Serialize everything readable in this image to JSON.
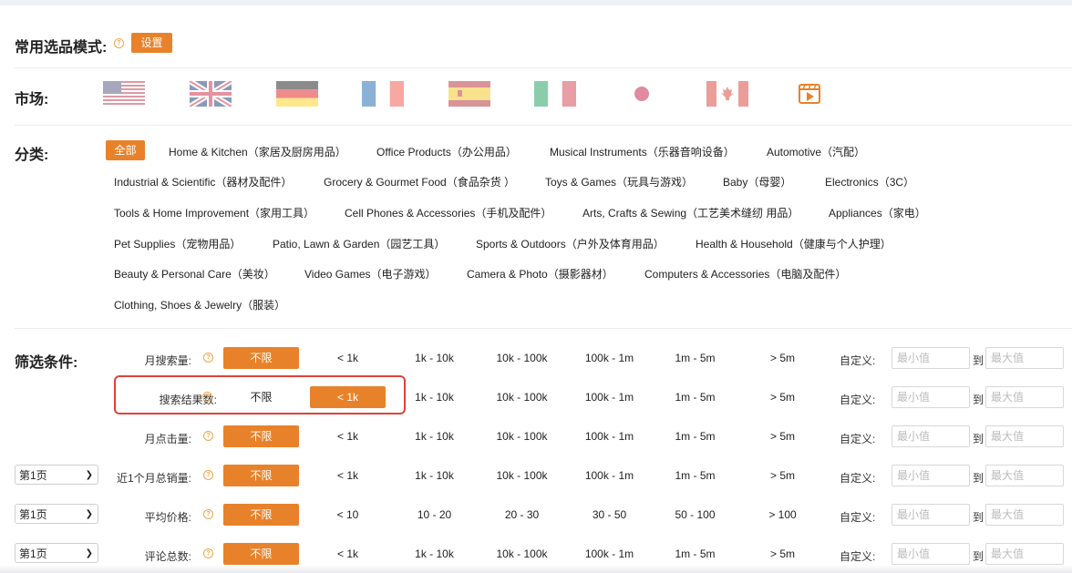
{
  "mode": {
    "label": "常用选品模式:",
    "button": "设置"
  },
  "market": {
    "label": "市场:",
    "flags": [
      "us-flag-icon",
      "uk-flag-icon",
      "de-flag-icon",
      "fr-flag-icon",
      "es-flag-icon",
      "it-flag-icon",
      "jp-flag-icon",
      "ca-flag-icon",
      "video-icon"
    ]
  },
  "category": {
    "label": "分类:",
    "all": "全部",
    "rows": [
      [
        "Home & Kitchen（家居及厨房用品）",
        "Office Products（办公用品）",
        "Musical Instruments（乐器音响设备）",
        "Automotive（汽配）"
      ],
      [
        "Industrial & Scientific（器材及配件）",
        "Grocery & Gourmet Food（食品杂货 ）",
        "Toys & Games（玩具与游戏）",
        "Baby（母婴）",
        "Electronics（3C）"
      ],
      [
        "Tools & Home Improvement（家用工具）",
        "Cell Phones & Accessories（手机及配件）",
        "Arts, Crafts & Sewing（工艺美术缝纫 用品）",
        "Appliances（家电）"
      ],
      [
        "Pet Supplies（宠物用品）",
        "Patio, Lawn & Garden（园艺工具）",
        "Sports & Outdoors（户外及体育用品）",
        "Health & Household（健康与个人护理）"
      ],
      [
        "Beauty & Personal Care（美妆）",
        "Video Games（电子游戏）",
        "Camera & Photo（摄影器材）",
        "Computers & Accessories（电脑及配件）"
      ],
      [
        "Clothing, Shoes & Jewelry（服装）"
      ]
    ]
  },
  "filters": {
    "label": "筛选条件:",
    "custom_label": "自定义:",
    "min_placeholder": "最小值",
    "max_placeholder": "最大值",
    "to_label": "到",
    "rows": [
      {
        "name": "月搜索量:",
        "page": "",
        "options": [
          "不限",
          "< 1k",
          "1k - 10k",
          "10k - 100k",
          "100k - 1m",
          "1m - 5m",
          "> 5m"
        ],
        "selected": 0
      },
      {
        "name": "搜索结果数:",
        "page": "",
        "options": [
          "不限",
          "< 1k",
          "1k - 10k",
          "10k - 100k",
          "100k - 1m",
          "1m - 5m",
          "> 5m"
        ],
        "selected": 1
      },
      {
        "name": "月点击量:",
        "page": "",
        "options": [
          "不限",
          "< 1k",
          "1k - 10k",
          "10k - 100k",
          "100k - 1m",
          "1m - 5m",
          "> 5m"
        ],
        "selected": 0
      },
      {
        "name": "近1个月总销量:",
        "page": "第1页",
        "options": [
          "不限",
          "< 1k",
          "1k - 10k",
          "10k - 100k",
          "100k - 1m",
          "1m - 5m",
          "> 5m"
        ],
        "selected": 0
      },
      {
        "name": "平均价格:",
        "page": "第1页",
        "options": [
          "不限",
          "< 10",
          "10 - 20",
          "20 - 30",
          "30 - 50",
          "50 - 100",
          "> 100"
        ],
        "selected": 0
      },
      {
        "name": "评论总数:",
        "page": "第1页",
        "options": [
          "不限",
          "< 1k",
          "1k - 10k",
          "10k - 100k",
          "100k - 1m",
          "1m - 5m",
          "> 5m"
        ],
        "selected": 0
      }
    ]
  },
  "colors": {
    "accent": "#e8822a",
    "highlight": "#e0423a"
  }
}
